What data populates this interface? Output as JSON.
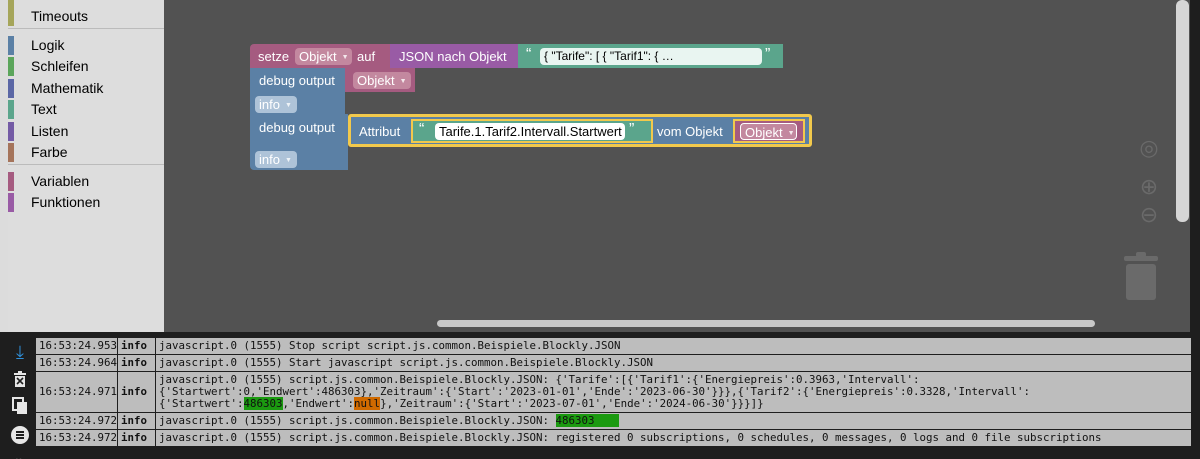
{
  "toolbox": {
    "categories": [
      {
        "label": "Timeouts",
        "color": "#a5a55a"
      },
      {
        "label": "Logik",
        "color": "#5b80a5"
      },
      {
        "label": "Schleifen",
        "color": "#5ba55b"
      },
      {
        "label": "Mathematik",
        "color": "#5b67a5"
      },
      {
        "label": "Text",
        "color": "#5ba58c"
      },
      {
        "label": "Listen",
        "color": "#745ba5"
      },
      {
        "label": "Farbe",
        "color": "#a5745b"
      },
      {
        "label": "Variablen",
        "color": "#a55b80"
      },
      {
        "label": "Funktionen",
        "color": "#995ba5"
      }
    ]
  },
  "blocks": {
    "set": {
      "label": "setze",
      "var": "Objekt",
      "to_label": "auf",
      "color": "#a55b80"
    },
    "json": {
      "label": "JSON nach Objekt",
      "color": "#995ba5"
    },
    "json_text": {
      "open_quote": "“",
      "value": "{   \"Tarife\": [     {       \"Tarif1\": {       …",
      "close_quote": "”",
      "color": "#5ba58c"
    },
    "debug1": {
      "label": "debug output",
      "var": "Objekt",
      "level": "info",
      "color": "#5b80a5"
    },
    "debug2": {
      "label": "debug output",
      "level": "info",
      "color": "#5b80a5"
    },
    "attr": {
      "label": "Attribut",
      "path": "Tarife.1.Tarif2.Intervall.Startwert",
      "of_label": "vom Objekt",
      "var": "Objekt",
      "color": "#5b80a5"
    }
  },
  "workspace": {
    "background": "#525252",
    "controls": [
      "crosshair-icon",
      "zoom-in-icon",
      "zoom-out-icon",
      "trash-icon"
    ]
  },
  "log": {
    "tools": [
      "scroll-down-icon",
      "clear-log-icon",
      "copy-icon",
      "filter-icon",
      "collapse-icon"
    ],
    "rows": [
      {
        "time": "16:53:24.953",
        "severity": "info",
        "message": "javascript.0 (1555) Stop script script.js.common.Beispiele.Blockly.JSON"
      },
      {
        "time": "16:53:24.964",
        "severity": "info",
        "message": "javascript.0 (1555) Start javascript script.js.common.Beispiele.Blockly.JSON"
      },
      {
        "time": "16:53:24.971",
        "severity": "info",
        "message_parts": [
          "javascript.0 (1555) script.js.common.Beispiele.Blockly.JSON: {'Tarife':[{'Tarif1':{'Energiepreis':0.3963,'Intervall':{'Startwert':0,'Endwert':486303},'Zeitraum':{'Start':'2023-01-01','Ende':'2023-06-30'}}},{'Tarif2':{'Energiepreis':0.3328,'Intervall':{'Startwert':",
          "486303",
          ",'Endwert':",
          "null",
          "},'Zeitraum':{'Start':'2023-07-01','Ende':'2024-06-30'}}}]}"
        ]
      },
      {
        "time": "16:53:24.972",
        "severity": "info",
        "message_prefix": "javascript.0 (1555) script.js.common.Beispiele.Blockly.JSON: ",
        "message_value": "486303"
      },
      {
        "time": "16:53:24.972",
        "severity": "info",
        "message": "javascript.0 (1555) script.js.common.Beispiele.Blockly.JSON: registered 0 subscriptions, 0 schedules, 0 messages, 0 logs and 0 file subscriptions"
      }
    ],
    "highlight_green": "#1b9a10",
    "highlight_orange": "#d06a00"
  }
}
